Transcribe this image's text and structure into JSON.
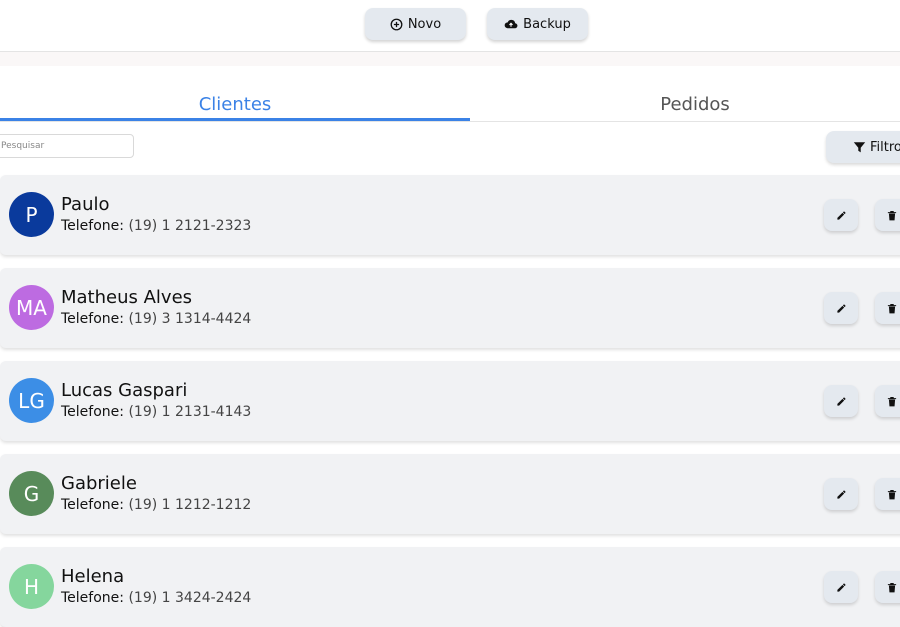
{
  "header": {
    "new_button": {
      "label": "Novo",
      "icon": "plus-circle-icon"
    },
    "backup_button": {
      "label": "Backup",
      "icon": "cloud-upload-icon"
    }
  },
  "tabs": [
    {
      "label": "Clientes",
      "active": true
    },
    {
      "label": "Pedidos",
      "active": false
    }
  ],
  "search": {
    "placeholder": "Pesquisar",
    "value": ""
  },
  "filter_button": {
    "label": "Filtros",
    "icon": "filter-icon"
  },
  "phone_label": "Telefone:",
  "clients": [
    {
      "initials": "P",
      "name": "Paulo",
      "phone": "(19) 1 2121-2323",
      "color": "#0a3a9c"
    },
    {
      "initials": "MA",
      "name": "Matheus Alves",
      "phone": "(19) 3 1314-4424",
      "color": "#bd6be1"
    },
    {
      "initials": "LG",
      "name": "Lucas Gaspari",
      "phone": "(19) 1 2131-4143",
      "color": "#3c8ee6"
    },
    {
      "initials": "G",
      "name": "Gabriele",
      "phone": "(19) 1 1212-1212",
      "color": "#588b5a"
    },
    {
      "initials": "H",
      "name": "Helena",
      "phone": "(19) 1 3424-2424",
      "color": "#85d69d"
    }
  ],
  "colors": {
    "accent": "#3b82e6",
    "button_bg": "#e4e9ef",
    "card_bg": "#f1f2f4"
  }
}
